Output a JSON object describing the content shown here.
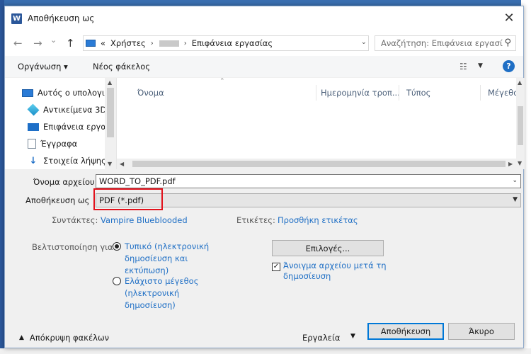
{
  "window": {
    "title": "Αποθήκευση ως",
    "app_icon": "word-icon"
  },
  "nav": {
    "back_icon": "←",
    "forward_icon": "→",
    "down_icon": "⌄",
    "up_icon": "↑",
    "breadcrumb": [
      "«",
      "Χρήστες",
      "Επιφάνεια εργασίας"
    ],
    "search_placeholder": "Αναζήτηση: Επιφάνεια εργασί"
  },
  "toolbar": {
    "organize": "Οργάνωση ▾",
    "new_folder": "Νέος φάκελος"
  },
  "tree": {
    "items": [
      {
        "label": "Αυτός ο υπολογι",
        "icon": "computer-icon"
      },
      {
        "label": "Αντικείμενα 3D",
        "icon": "3d-objects-icon"
      },
      {
        "label": "Επιφάνεια εργασ",
        "icon": "desktop-icon"
      },
      {
        "label": "Έγγραφα",
        "icon": "documents-icon"
      },
      {
        "label": "Στοιχεία λήψης",
        "icon": "downloads-icon"
      }
    ]
  },
  "file_list": {
    "columns": [
      "Όνομα",
      "Ημερομηνία τροπ...",
      "Τύπος",
      "Μέγεθο"
    ]
  },
  "form": {
    "filename_label": "Όνομα αρχείου:",
    "filename_value": "WORD_TO_PDF.pdf",
    "savetype_label": "Αποθήκευση ως",
    "savetype_value": "PDF (*.pdf)",
    "authors_label": "Συντάκτες:",
    "authors_value": "Vampire Blueblooded",
    "tags_label": "Ετικέτες:",
    "tags_value": "Προσθήκη ετικέτας"
  },
  "optimize": {
    "label": "Βελτιστοποίηση για:",
    "opt1": [
      "Τυπικό (ηλεκτρονική",
      "δημοσίευση και",
      "εκτύπωση)"
    ],
    "opt2": [
      "Ελάχιστο μέγεθος",
      "(ηλεκτρονική",
      "δημοσίευση)"
    ]
  },
  "options_button": "Επιλογές...",
  "open_after": [
    "Άνοιγμα αρχείου μετά τη",
    "δημοσίευση"
  ],
  "footer": {
    "hide_folders": "Απόκρυψη φακέλων",
    "tools": "Εργαλεία",
    "save": "Αποθήκευση",
    "cancel": "Άκυρο"
  }
}
